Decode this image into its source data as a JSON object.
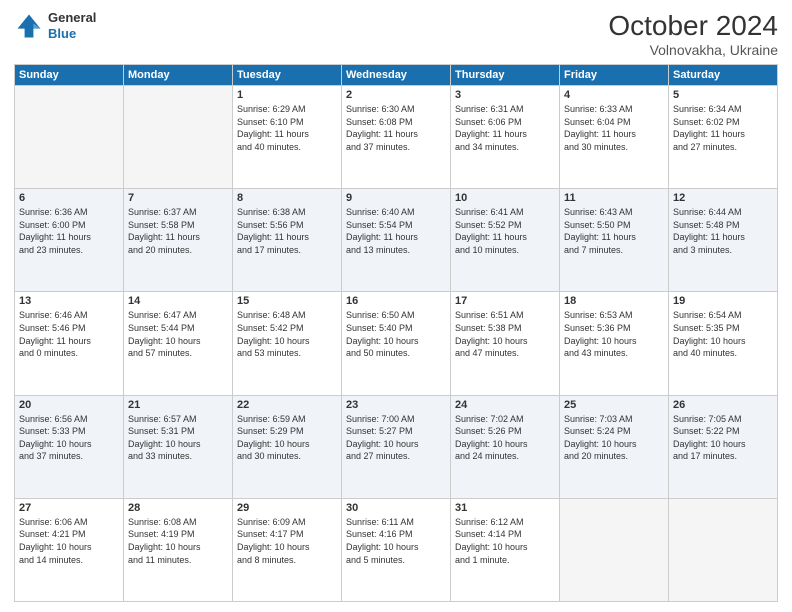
{
  "header": {
    "logo_line1": "General",
    "logo_line2": "Blue",
    "month": "October 2024",
    "location": "Volnovakha, Ukraine"
  },
  "weekdays": [
    "Sunday",
    "Monday",
    "Tuesday",
    "Wednesday",
    "Thursday",
    "Friday",
    "Saturday"
  ],
  "weeks": [
    [
      {
        "day": "",
        "info": ""
      },
      {
        "day": "",
        "info": ""
      },
      {
        "day": "1",
        "info": "Sunrise: 6:29 AM\nSunset: 6:10 PM\nDaylight: 11 hours\nand 40 minutes."
      },
      {
        "day": "2",
        "info": "Sunrise: 6:30 AM\nSunset: 6:08 PM\nDaylight: 11 hours\nand 37 minutes."
      },
      {
        "day": "3",
        "info": "Sunrise: 6:31 AM\nSunset: 6:06 PM\nDaylight: 11 hours\nand 34 minutes."
      },
      {
        "day": "4",
        "info": "Sunrise: 6:33 AM\nSunset: 6:04 PM\nDaylight: 11 hours\nand 30 minutes."
      },
      {
        "day": "5",
        "info": "Sunrise: 6:34 AM\nSunset: 6:02 PM\nDaylight: 11 hours\nand 27 minutes."
      }
    ],
    [
      {
        "day": "6",
        "info": "Sunrise: 6:36 AM\nSunset: 6:00 PM\nDaylight: 11 hours\nand 23 minutes."
      },
      {
        "day": "7",
        "info": "Sunrise: 6:37 AM\nSunset: 5:58 PM\nDaylight: 11 hours\nand 20 minutes."
      },
      {
        "day": "8",
        "info": "Sunrise: 6:38 AM\nSunset: 5:56 PM\nDaylight: 11 hours\nand 17 minutes."
      },
      {
        "day": "9",
        "info": "Sunrise: 6:40 AM\nSunset: 5:54 PM\nDaylight: 11 hours\nand 13 minutes."
      },
      {
        "day": "10",
        "info": "Sunrise: 6:41 AM\nSunset: 5:52 PM\nDaylight: 11 hours\nand 10 minutes."
      },
      {
        "day": "11",
        "info": "Sunrise: 6:43 AM\nSunset: 5:50 PM\nDaylight: 11 hours\nand 7 minutes."
      },
      {
        "day": "12",
        "info": "Sunrise: 6:44 AM\nSunset: 5:48 PM\nDaylight: 11 hours\nand 3 minutes."
      }
    ],
    [
      {
        "day": "13",
        "info": "Sunrise: 6:46 AM\nSunset: 5:46 PM\nDaylight: 11 hours\nand 0 minutes."
      },
      {
        "day": "14",
        "info": "Sunrise: 6:47 AM\nSunset: 5:44 PM\nDaylight: 10 hours\nand 57 minutes."
      },
      {
        "day": "15",
        "info": "Sunrise: 6:48 AM\nSunset: 5:42 PM\nDaylight: 10 hours\nand 53 minutes."
      },
      {
        "day": "16",
        "info": "Sunrise: 6:50 AM\nSunset: 5:40 PM\nDaylight: 10 hours\nand 50 minutes."
      },
      {
        "day": "17",
        "info": "Sunrise: 6:51 AM\nSunset: 5:38 PM\nDaylight: 10 hours\nand 47 minutes."
      },
      {
        "day": "18",
        "info": "Sunrise: 6:53 AM\nSunset: 5:36 PM\nDaylight: 10 hours\nand 43 minutes."
      },
      {
        "day": "19",
        "info": "Sunrise: 6:54 AM\nSunset: 5:35 PM\nDaylight: 10 hours\nand 40 minutes."
      }
    ],
    [
      {
        "day": "20",
        "info": "Sunrise: 6:56 AM\nSunset: 5:33 PM\nDaylight: 10 hours\nand 37 minutes."
      },
      {
        "day": "21",
        "info": "Sunrise: 6:57 AM\nSunset: 5:31 PM\nDaylight: 10 hours\nand 33 minutes."
      },
      {
        "day": "22",
        "info": "Sunrise: 6:59 AM\nSunset: 5:29 PM\nDaylight: 10 hours\nand 30 minutes."
      },
      {
        "day": "23",
        "info": "Sunrise: 7:00 AM\nSunset: 5:27 PM\nDaylight: 10 hours\nand 27 minutes."
      },
      {
        "day": "24",
        "info": "Sunrise: 7:02 AM\nSunset: 5:26 PM\nDaylight: 10 hours\nand 24 minutes."
      },
      {
        "day": "25",
        "info": "Sunrise: 7:03 AM\nSunset: 5:24 PM\nDaylight: 10 hours\nand 20 minutes."
      },
      {
        "day": "26",
        "info": "Sunrise: 7:05 AM\nSunset: 5:22 PM\nDaylight: 10 hours\nand 17 minutes."
      }
    ],
    [
      {
        "day": "27",
        "info": "Sunrise: 6:06 AM\nSunset: 4:21 PM\nDaylight: 10 hours\nand 14 minutes."
      },
      {
        "day": "28",
        "info": "Sunrise: 6:08 AM\nSunset: 4:19 PM\nDaylight: 10 hours\nand 11 minutes."
      },
      {
        "day": "29",
        "info": "Sunrise: 6:09 AM\nSunset: 4:17 PM\nDaylight: 10 hours\nand 8 minutes."
      },
      {
        "day": "30",
        "info": "Sunrise: 6:11 AM\nSunset: 4:16 PM\nDaylight: 10 hours\nand 5 minutes."
      },
      {
        "day": "31",
        "info": "Sunrise: 6:12 AM\nSunset: 4:14 PM\nDaylight: 10 hours\nand 1 minute."
      },
      {
        "day": "",
        "info": ""
      },
      {
        "day": "",
        "info": ""
      }
    ]
  ]
}
